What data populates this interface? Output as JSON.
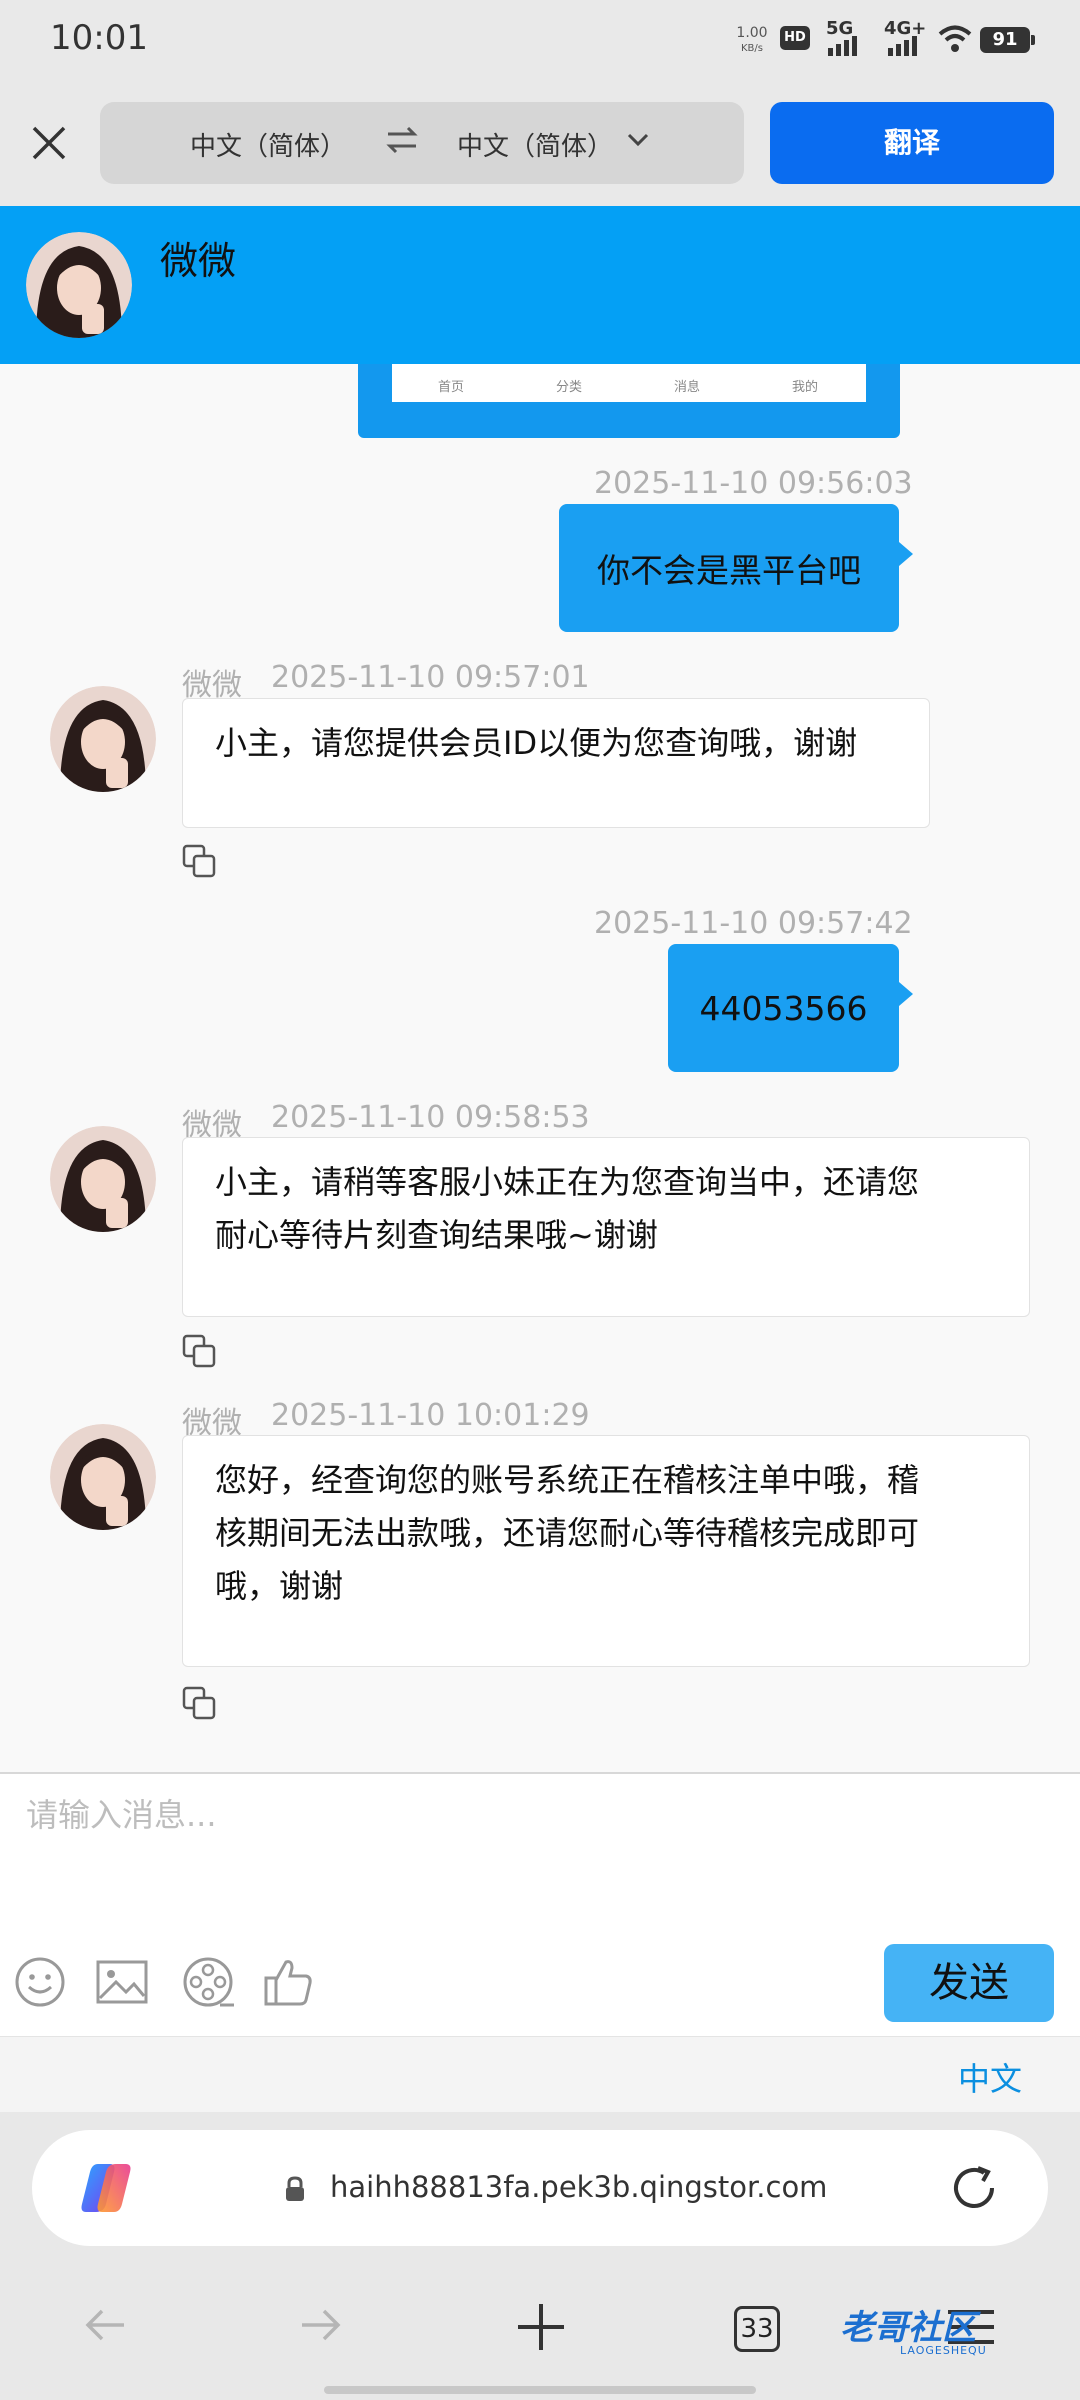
{
  "status_bar": {
    "time": "10:01",
    "net_speed_value": "1.00",
    "net_speed_unit": "KB/s",
    "hd_label": "HD",
    "sig1_label": "5G",
    "sig2_label": "4G+",
    "battery": "91"
  },
  "translate_bar": {
    "source_lang": "中文（简体）",
    "target_lang": "中文（简体）",
    "translate_button": "翻译"
  },
  "chat": {
    "contact_name": "微微",
    "image_tabs": [
      "首页",
      "分类",
      "消息",
      "我的"
    ],
    "messages": [
      {
        "timestamp": "2025-11-10 09:56:03",
        "text": "你不会是黑平台吧"
      },
      {
        "sender": "微微",
        "timestamp": "2025-11-10 09:57:01",
        "line1": "小主，请您提供会员ID以便为您查询哦，谢谢"
      },
      {
        "timestamp": "2025-11-10 09:57:42",
        "text": "44053566"
      },
      {
        "sender": "微微",
        "timestamp": "2025-11-10 09:58:53",
        "line1": "小主，请稍等客服小妹正在为您查询当中，还请您",
        "line2": "耐心等待片刻查询结果哦~谢谢"
      },
      {
        "sender": "微微",
        "timestamp": "2025-11-10 10:01:29",
        "line1": "您好，经查询您的账号系统正在稽核注单中哦，稽",
        "line2": "核期间无法出款哦，还请您耐心等待稽核完成即可",
        "line3": "哦，谢谢"
      }
    ]
  },
  "composer": {
    "placeholder": "请输入消息...",
    "send_button": "发送",
    "language_indicator": "中文"
  },
  "browser": {
    "url": "haihh88813fa.pek3b.qingstor.com",
    "tab_count": "33",
    "watermark": "老哥社区",
    "watermark_sub": "LAOGESHEQU"
  },
  "colors": {
    "header_blue": "#04a0f5",
    "outgoing_bubble": "#1a9ff2",
    "translate_button": "#0a6cf0",
    "send_button": "#45b3f5"
  }
}
